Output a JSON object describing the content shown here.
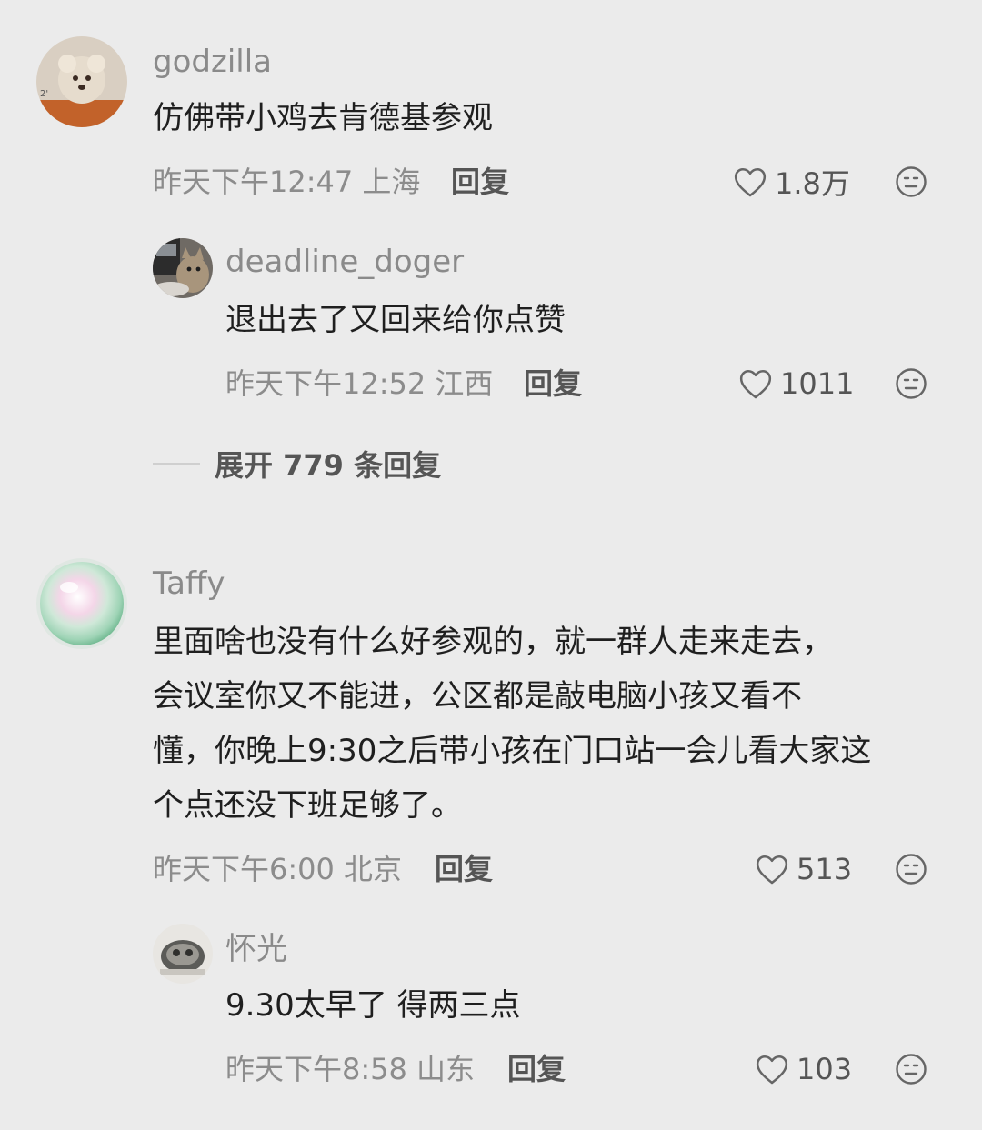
{
  "comments": [
    {
      "username": "godzilla",
      "text": "仿佛带小鸡去肯德基参观",
      "meta": "昨天下午12:47 上海",
      "reply_label": "回复",
      "likes": "1.8万",
      "replies": [
        {
          "username": "deadline_doger",
          "text": "退出去了又回来给你点赞",
          "meta": "昨天下午12:52 江西",
          "reply_label": "回复",
          "likes": "1011"
        }
      ],
      "expand_label": "展开 779 条回复"
    },
    {
      "username": "Taffy",
      "text_lines": [
        "里面啥也没有什么好参观的，就一群人走来走去，",
        "会议室你又不能进，公区都是敲电脑小孩又看不",
        "懂，你晚上9:30之后带小孩在门口站一会儿看大家这",
        "个点还没下班足够了。"
      ],
      "meta": "昨天下午6:00 北京",
      "reply_label": "回复",
      "likes": "513",
      "replies": [
        {
          "username": "怀光",
          "text": "9.30太早了 得两三点",
          "meta": "昨天下午8:58 山东",
          "reply_label": "回复",
          "likes": "103"
        }
      ]
    }
  ],
  "icons": {
    "like": "heart-outline-icon",
    "emoji": "smiley-face-icon"
  },
  "colors": {
    "background": "#ebebeb",
    "username": "#8a8a8a",
    "text": "#1f1f1f",
    "meta": "#8c8c8c"
  }
}
